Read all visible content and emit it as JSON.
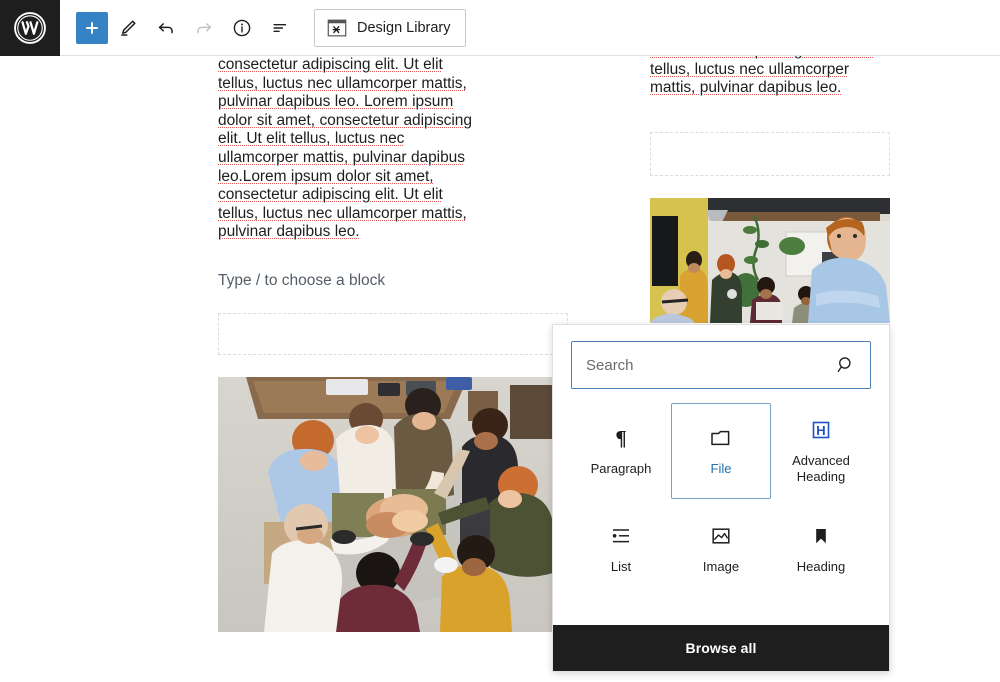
{
  "header": {
    "logo_icon": "wordpress-logo-icon",
    "tools": [
      {
        "name": "add-block-button",
        "icon": "plus-icon",
        "label": "Add block",
        "variant": "primary",
        "disabled": false
      },
      {
        "name": "edit-tool-button",
        "icon": "pencil-icon",
        "label": "Edit",
        "variant": "default",
        "disabled": false
      },
      {
        "name": "undo-button",
        "icon": "undo-arrow-icon",
        "label": "Undo",
        "variant": "default",
        "disabled": false
      },
      {
        "name": "redo-button",
        "icon": "redo-arrow-icon",
        "label": "Redo",
        "variant": "default",
        "disabled": true
      },
      {
        "name": "details-button",
        "icon": "info-circle-icon",
        "label": "Details",
        "variant": "default",
        "disabled": false
      },
      {
        "name": "list-view-button",
        "icon": "list-view-icon",
        "label": "List view",
        "variant": "default",
        "disabled": false
      }
    ],
    "design_library": {
      "label": "Design Library",
      "icon": "design-library-icon"
    }
  },
  "canvas": {
    "left_column": {
      "paragraph": "consectetur adipiscing elit. Ut elit tellus, luctus nec ullamcorper mattis, pulvinar dapibus leo. Lorem ipsum dolor sit amet, consectetur adipiscing elit. Ut elit tellus, luctus nec ullamcorper mattis, pulvinar dapibus leo.Lorem ipsum dolor sit amet, consectetur adipiscing elit. Ut elit tellus, luctus nec ullamcorper mattis, pulvinar dapibus leo.",
      "empty_block_hint": "Type / to choose a block",
      "image_alt": "team-huddle-hands-together-overhead-photo"
    },
    "right_column": {
      "paragraph": "consectetur adipiscing elit. Ut elit tellus, luctus nec ullamcorper mattis, pulvinar dapibus leo.",
      "image_alt": "office-team-meeting-man-in-blue-shirt-photo",
      "bottom_paragraph": "luctus nec ullamcorper mattis,"
    },
    "inline_adder_icon": "plus-icon"
  },
  "inserter": {
    "search": {
      "placeholder": "Search",
      "value": "",
      "icon": "search-magnifier-icon"
    },
    "blocks": [
      {
        "label": "Paragraph",
        "icon": "pilcrow-paragraph-icon",
        "selected": false
      },
      {
        "label": "File",
        "icon": "folder-file-icon",
        "selected": true
      },
      {
        "label": "Advanced\nHeading",
        "icon": "advanced-heading-h-icon",
        "selected": false
      },
      {
        "label": "List",
        "icon": "bulleted-list-icon",
        "selected": false
      },
      {
        "label": "Image",
        "icon": "image-picture-icon",
        "selected": false
      },
      {
        "label": "Heading",
        "icon": "bookmark-heading-icon",
        "selected": false
      }
    ],
    "browse_all_label": "Browse all"
  },
  "colors": {
    "accent_blue": "#3582c4",
    "link_blue": "#2271b1",
    "dark": "#1e1e1e",
    "border": "#e0e0e0",
    "spellcheck_red": "#e03c3c",
    "focus_border": "#4b7fb3"
  }
}
